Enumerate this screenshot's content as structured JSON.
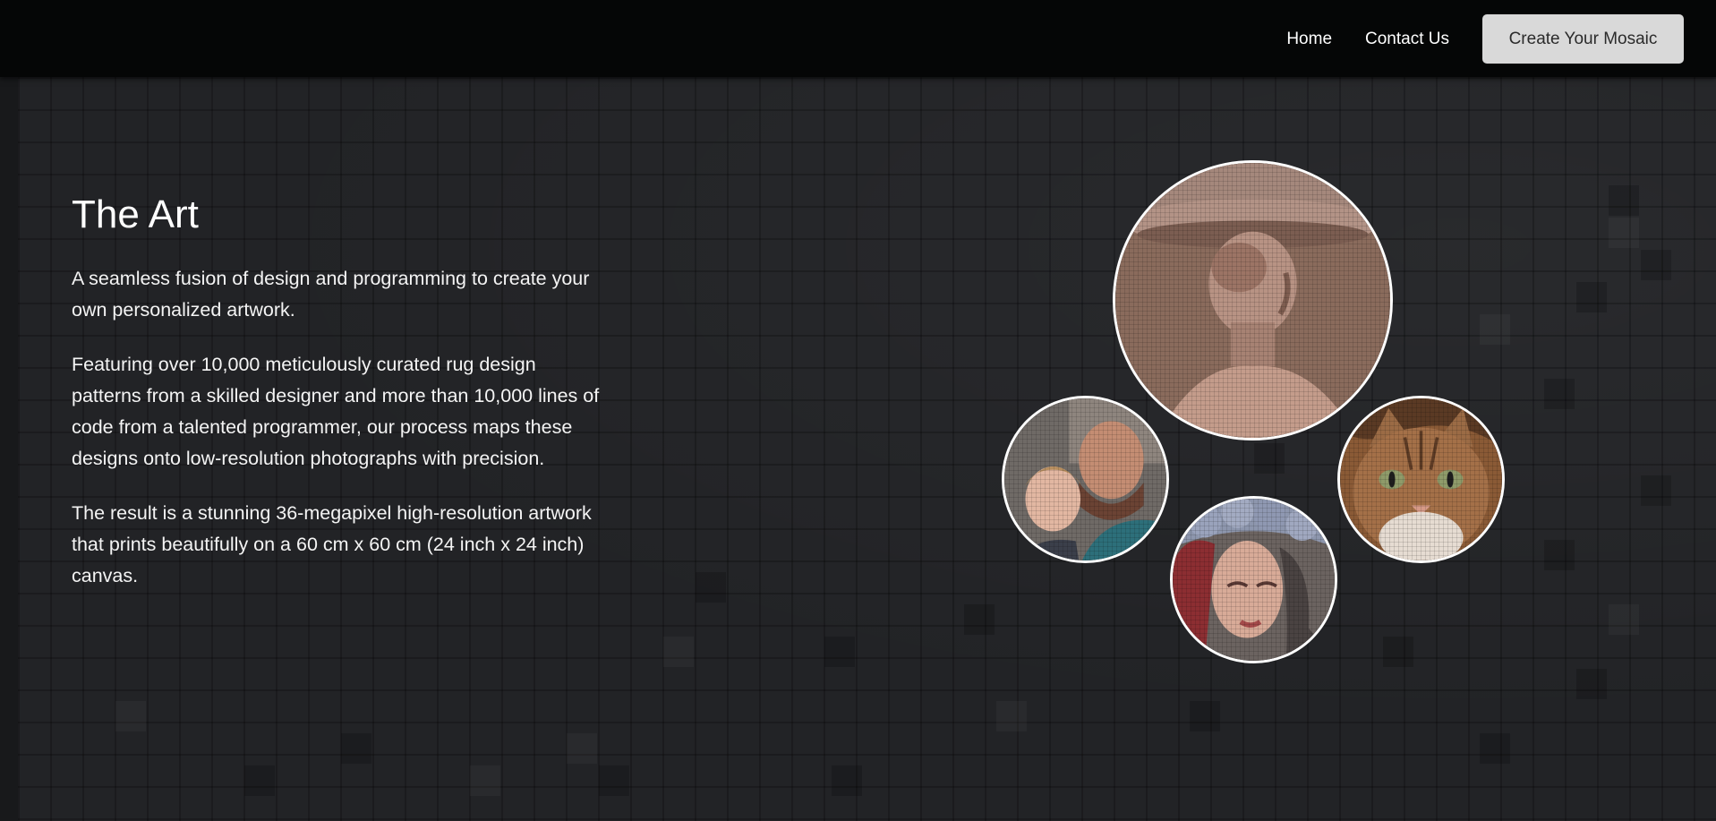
{
  "nav": {
    "home_label": "Home",
    "contact_label": "Contact Us",
    "cta_label": "Create Your Mosaic"
  },
  "main": {
    "title": "The Art",
    "paragraphs": [
      "A seamless fusion of design and programming to create your own personalized artwork.",
      "Featuring over 10,000 meticulously curated rug design patterns from a skilled designer and more than 10,000 lines of code from a talented programmer, our process maps these designs onto low-resolution photographs with precision.",
      "The result is a stunning 36-megapixel high-resolution artwork that prints beautifully on a 60 cm x 60 cm (24 inch x 24 inch) canvas."
    ]
  },
  "gallery": {
    "images": [
      {
        "name": "statue-mosaic-image"
      },
      {
        "name": "father-child-mosaic-image"
      },
      {
        "name": "woman-flowers-mosaic-image"
      },
      {
        "name": "cat-mosaic-image"
      }
    ]
  },
  "colors": {
    "navbar_bg": "#050606",
    "page_bg": "#222326",
    "cta_bg": "#d9d9d9",
    "text": "#ffffff"
  }
}
